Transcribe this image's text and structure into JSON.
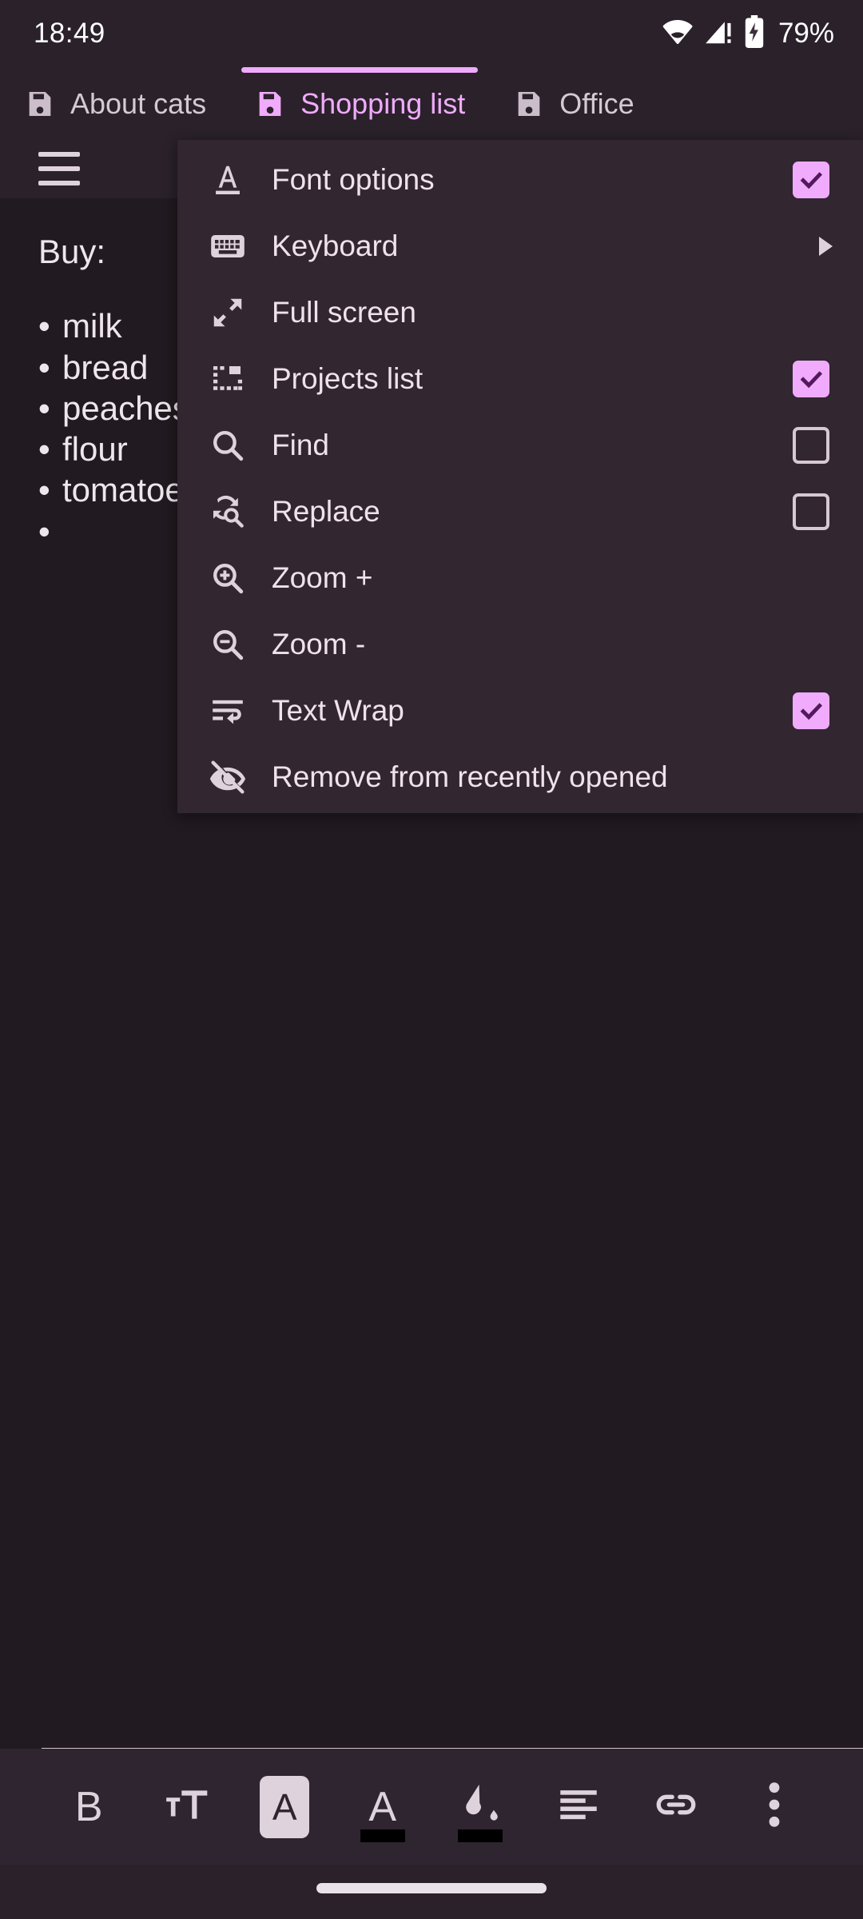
{
  "status_bar": {
    "clock": "18:49",
    "battery_text": "79%",
    "icons": [
      "wifi-icon",
      "cellular-signal-icon",
      "battery-charging-icon"
    ]
  },
  "tabs": [
    {
      "label": "About cats",
      "icon": "floppy-disk-icon",
      "active": false
    },
    {
      "label": "Shopping list",
      "icon": "floppy-disk-icon",
      "active": true
    },
    {
      "label": "Office",
      "icon": "floppy-disk-icon",
      "active": false
    }
  ],
  "document": {
    "menu_icon": "hamburger-menu-icon",
    "title": "Buy:",
    "items": [
      "milk",
      "bread",
      "peaches",
      "flour",
      "tomatoes",
      ""
    ],
    "bullet": "•"
  },
  "popup_menu": {
    "items": [
      {
        "label": "Font options",
        "icon": "font-underline-icon",
        "control": "checkbox",
        "checked": true
      },
      {
        "label": "Keyboard",
        "icon": "keyboard-icon",
        "control": "submenu-arrow"
      },
      {
        "label": "Full screen",
        "icon": "fullscreen-expand-icon",
        "control": "none"
      },
      {
        "label": "Projects list",
        "icon": "projects-list-icon",
        "control": "checkbox",
        "checked": true
      },
      {
        "label": "Find",
        "icon": "search-icon",
        "control": "checkbox",
        "checked": false
      },
      {
        "label": "Replace",
        "icon": "find-replace-icon",
        "control": "checkbox",
        "checked": false
      },
      {
        "label": "Zoom +",
        "icon": "zoom-in-icon",
        "control": "none"
      },
      {
        "label": "Zoom -",
        "icon": "zoom-out-icon",
        "control": "none"
      },
      {
        "label": "Text Wrap",
        "icon": "text-wrap-icon",
        "control": "checkbox",
        "checked": true
      },
      {
        "label": "Remove from recently opened",
        "icon": "eye-off-icon",
        "control": "none"
      }
    ]
  },
  "bottom_toolbar": {
    "buttons": [
      {
        "name": "bold-button",
        "label": "B",
        "icon": "bold-icon"
      },
      {
        "name": "font-size-button",
        "label": "TT",
        "icon": "font-size-icon"
      },
      {
        "name": "text-style-button",
        "label": "A",
        "icon": "text-style-boxed-icon"
      },
      {
        "name": "text-color-button",
        "label": "A",
        "icon": "text-color-icon"
      },
      {
        "name": "fill-color-button",
        "label": "",
        "icon": "paint-bucket-icon"
      },
      {
        "name": "align-left-button",
        "label": "",
        "icon": "align-left-icon"
      },
      {
        "name": "link-button",
        "label": "",
        "icon": "link-icon"
      },
      {
        "name": "overflow-menu-button",
        "label": "",
        "icon": "more-vertical-icon"
      }
    ]
  },
  "colors": {
    "accent": "#f0abfc",
    "chrome_bg": "#2a212b",
    "doc_bg": "#211a20",
    "menu_bg": "#322631",
    "toolbar_bg": "#2f2530",
    "text": "#efe6ec",
    "icon": "#ded2dc"
  }
}
